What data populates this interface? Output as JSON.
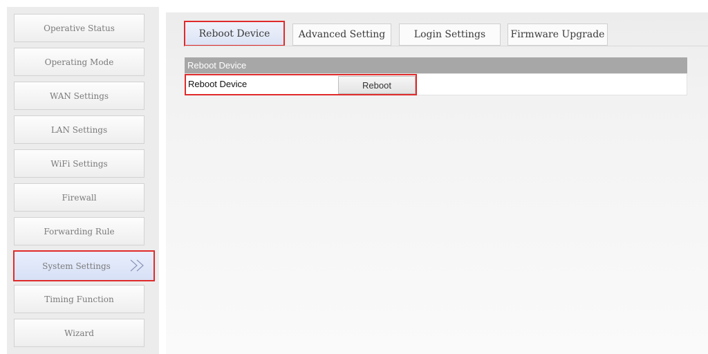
{
  "sidebar": {
    "items": [
      {
        "label": "Operative Status"
      },
      {
        "label": "Operating Mode"
      },
      {
        "label": "WAN Settings"
      },
      {
        "label": "LAN Settings"
      },
      {
        "label": "WiFi Settings"
      },
      {
        "label": "Firewall"
      },
      {
        "label": "Forwarding Rule"
      },
      {
        "label": "System Settings",
        "active": true,
        "icon": "double-chevron-right-icon"
      },
      {
        "label": "Timing Function"
      },
      {
        "label": "Wizard"
      }
    ]
  },
  "tabs": [
    {
      "label": "Reboot Device",
      "active": true
    },
    {
      "label": "Advanced Setting"
    },
    {
      "label": "Login Settings"
    },
    {
      "label": "Firmware Upgrade"
    }
  ],
  "section": {
    "header": "Reboot Device",
    "row_label": "Reboot Device",
    "button_label": "Reboot"
  },
  "colors": {
    "highlight_border": "#e02a2a",
    "section_header_bg": "#a7a7a7",
    "active_bg": "#dbe3f4"
  }
}
